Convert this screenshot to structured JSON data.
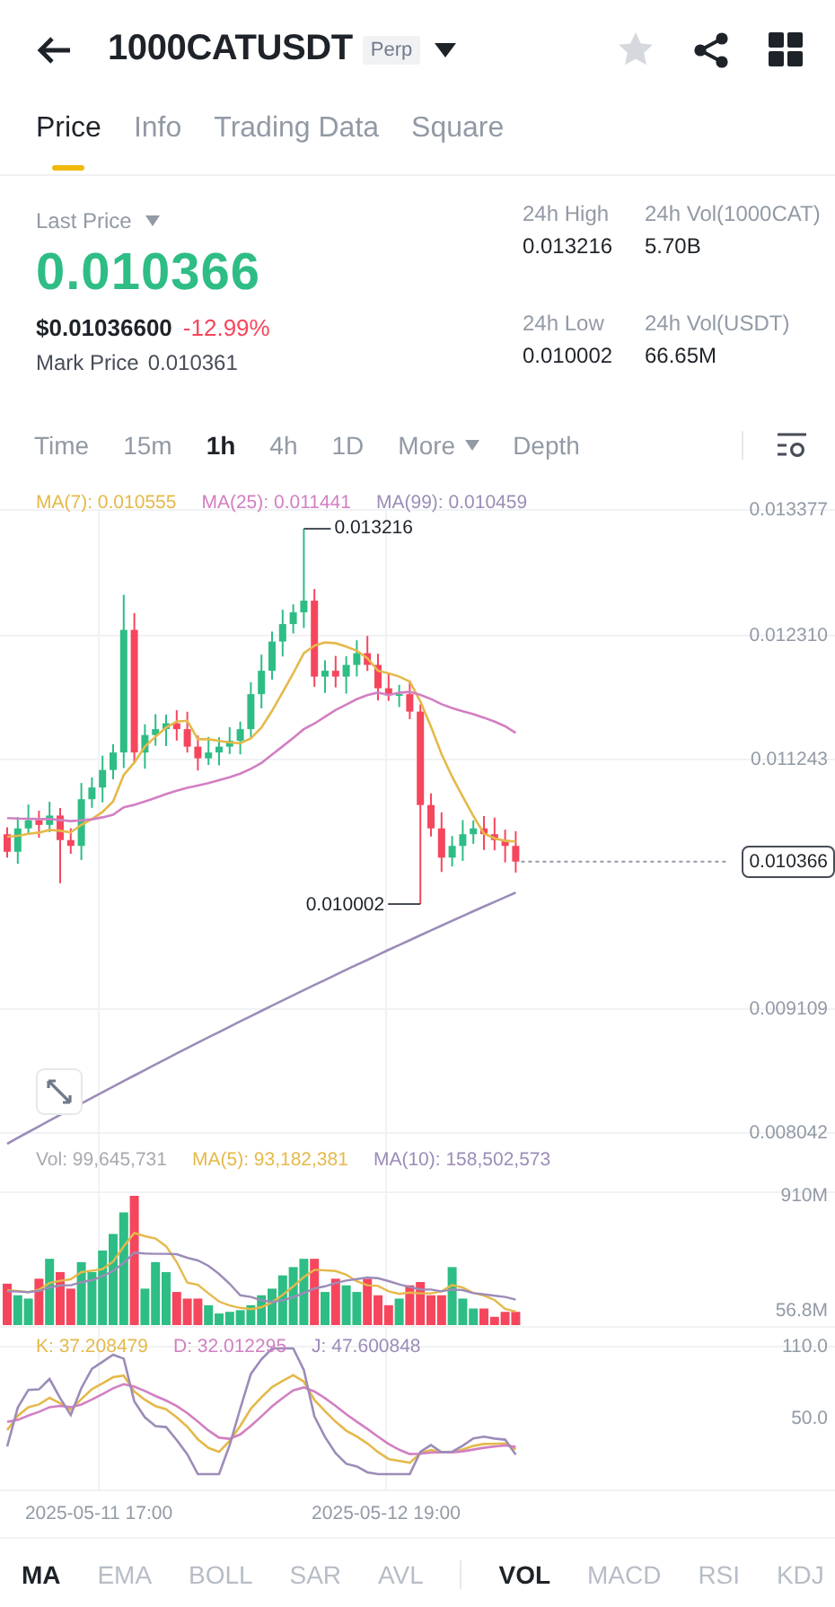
{
  "header": {
    "symbol": "1000CATUSDT",
    "badge": "Perp",
    "favorite": false
  },
  "tabs": [
    {
      "label": "Price",
      "selected": true
    },
    {
      "label": "Info",
      "selected": false
    },
    {
      "label": "Trading Data",
      "selected": false
    },
    {
      "label": "Square",
      "selected": false
    }
  ],
  "summary": {
    "last_price_label": "Last Price",
    "last_price": "0.010366",
    "usd_price": "$0.01036600",
    "change": "-12.99%",
    "mark_price_label": "Mark Price",
    "mark_price": "0.010361"
  },
  "stats": [
    {
      "label": "24h High",
      "value": "0.013216"
    },
    {
      "label": "24h Vol(1000CAT)",
      "value": "5.70B"
    },
    {
      "label": "24h Low",
      "value": "0.010002"
    },
    {
      "label": "24h Vol(USDT)",
      "value": "66.65M"
    }
  ],
  "intervals": [
    {
      "label": "Time",
      "kind": "option",
      "selected": false
    },
    {
      "label": "15m",
      "kind": "option",
      "selected": false
    },
    {
      "label": "1h",
      "kind": "option",
      "selected": true
    },
    {
      "label": "4h",
      "kind": "option",
      "selected": false
    },
    {
      "label": "1D",
      "kind": "option",
      "selected": false
    },
    {
      "label": "More",
      "kind": "menu",
      "selected": false
    },
    {
      "label": "Depth",
      "kind": "option",
      "selected": false
    }
  ],
  "chart": {
    "ma_legend": [
      {
        "label": "MA(7): 0.010555",
        "color": "#e5b94a"
      },
      {
        "label": "MA(25): 0.011441",
        "color": "#d27fc2"
      },
      {
        "label": "MA(99): 0.010459",
        "color": "#9c8cb8"
      }
    ],
    "price_axis": [
      "0.013377",
      "0.012310",
      "0.011243",
      "0.009109",
      "0.008042"
    ],
    "last_price_tag": "0.010366",
    "high_marker": "0.013216",
    "low_marker": "0.010002"
  },
  "volume": {
    "legend": [
      {
        "label": "Vol: 99,645,731",
        "color": "#a8a8b0"
      },
      {
        "label": "MA(5): 93,182,381",
        "color": "#e5b94a"
      },
      {
        "label": "MA(10): 158,502,573",
        "color": "#9c8cb8"
      }
    ],
    "axis": [
      "910M",
      "56.8M"
    ]
  },
  "kdj": {
    "legend": [
      {
        "label": "K: 37.208479",
        "color": "#e5b94a"
      },
      {
        "label": "D: 32.012295",
        "color": "#d27fc2"
      },
      {
        "label": "J: 47.600848",
        "color": "#9c8cb8"
      }
    ],
    "axis": [
      "110.0",
      "50.0"
    ]
  },
  "time_axis": [
    "2025-05-11 17:00",
    "2025-05-12 19:00"
  ],
  "indicators": {
    "main": [
      {
        "label": "MA",
        "selected": true
      },
      {
        "label": "EMA",
        "selected": false
      },
      {
        "label": "BOLL",
        "selected": false
      },
      {
        "label": "SAR",
        "selected": false
      },
      {
        "label": "AVL",
        "selected": false
      }
    ],
    "sub": [
      {
        "label": "VOL",
        "selected": true
      },
      {
        "label": "MACD",
        "selected": false
      },
      {
        "label": "RSI",
        "selected": false
      },
      {
        "label": "KDJ",
        "selected": false
      }
    ]
  }
}
